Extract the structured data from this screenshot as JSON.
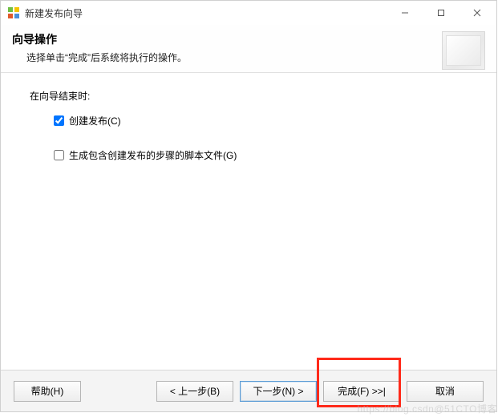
{
  "titlebar": {
    "title": "新建发布向导"
  },
  "header": {
    "heading": "向导操作",
    "subtitle": "选择单击“完成”后系统将执行的操作。"
  },
  "content": {
    "section_label": "在向导结束时:",
    "options": [
      {
        "label": "创建发布(C)",
        "checked": true
      },
      {
        "label": "生成包含创建发布的步骤的脚本文件(G)",
        "checked": false
      }
    ]
  },
  "footer": {
    "help": "帮助(H)",
    "back": "< 上一步(B)",
    "next": "下一步(N) >",
    "finish": "完成(F) >>|",
    "cancel": "取消"
  },
  "watermark": "https://blog.csdn@51CTO博客"
}
